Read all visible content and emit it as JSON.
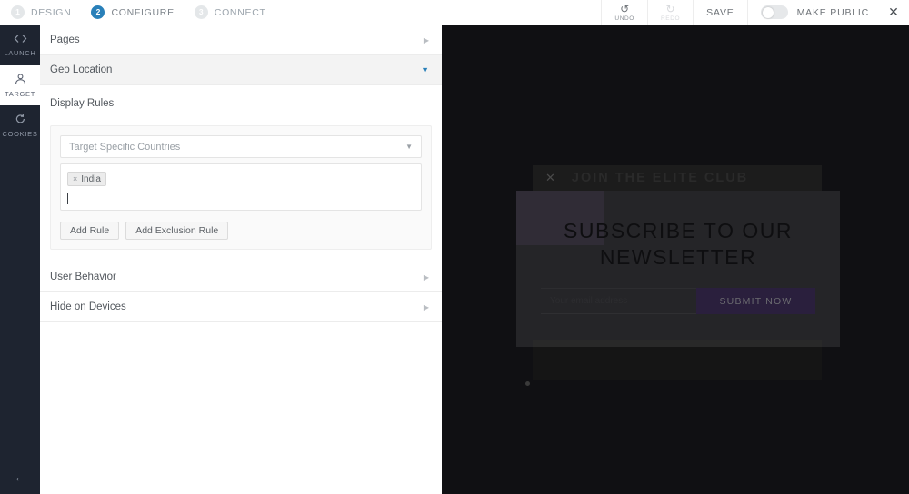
{
  "header": {
    "steps": [
      {
        "num": "1",
        "label": "DESIGN",
        "active": false
      },
      {
        "num": "2",
        "label": "CONFIGURE",
        "active": true
      },
      {
        "num": "3",
        "label": "CONNECT",
        "active": false
      }
    ],
    "undo": {
      "icon": "undo-icon",
      "glyph": "↺",
      "label": "UNDO"
    },
    "redo": {
      "icon": "redo-icon",
      "glyph": "↻",
      "label": "REDO"
    },
    "save_label": "SAVE",
    "make_public_label": "MAKE PUBLIC",
    "close_glyph": "✕"
  },
  "sidebar": {
    "items": [
      {
        "label": "LAUNCH",
        "icon": "code-icon",
        "glyph": "‹›",
        "active": false
      },
      {
        "label": "TARGET",
        "icon": "user-target-icon",
        "glyph": "⚫",
        "active": true
      },
      {
        "label": "COOKIES",
        "icon": "cookies-refresh-icon",
        "glyph": "↺",
        "active": false
      }
    ],
    "back_glyph": "←"
  },
  "panel": {
    "sections": [
      {
        "label": "Pages",
        "expanded": false,
        "arrow": "▶"
      },
      {
        "label": "Geo Location",
        "expanded": true,
        "arrow": "▼"
      }
    ],
    "display_rules_title": "Display Rules",
    "rule": {
      "select_value": "Target Specific Countries",
      "select_arrow": "▼",
      "tags": [
        {
          "label": "India",
          "remove_glyph": "×"
        }
      ],
      "add_rule_label": "Add Rule",
      "add_exclusion_label": "Add Exclusion Rule"
    },
    "sections_bottom": [
      {
        "label": "User Behavior",
        "expanded": false,
        "arrow": "▶"
      },
      {
        "label": "Hide on Devices",
        "expanded": false,
        "arrow": "▶"
      }
    ]
  },
  "preview": {
    "elite_bar": {
      "text": "JOIN THE ELITE CLUB",
      "close_glyph": "✕"
    },
    "modal": {
      "title": "SUBSCRIBE TO OUR NEWSLETTER",
      "email_placeholder": "Your email address",
      "submit_label": "SUBMIT NOW"
    }
  },
  "colors": {
    "accent_blue": "#2980b9",
    "sidebar_dark": "#1e2430",
    "preview_bg": "#0d0d0f",
    "submit_purple": "#2a1f3d"
  }
}
